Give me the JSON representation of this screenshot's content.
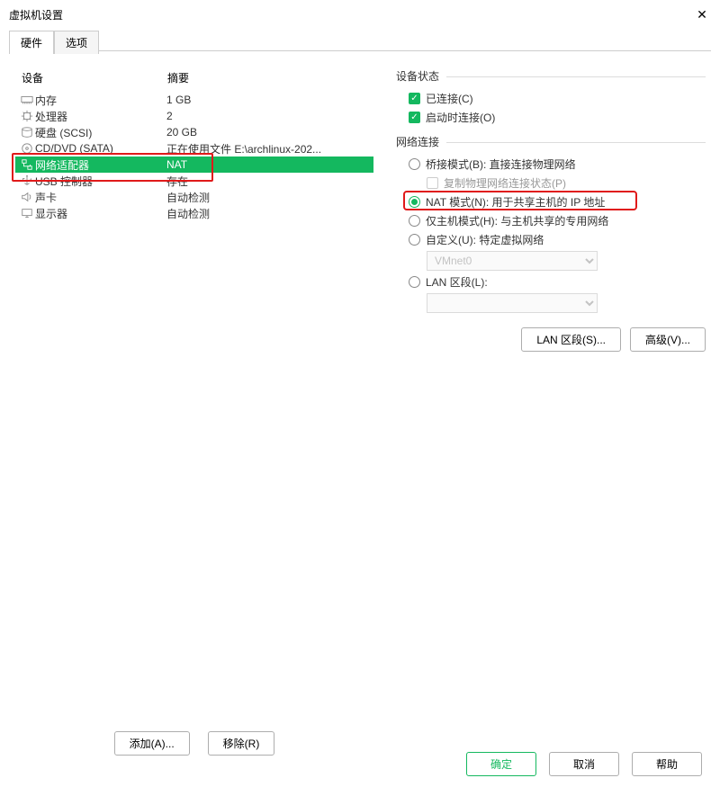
{
  "colors": {
    "accent": "#14b85f",
    "highlight": "#e01a1a"
  },
  "title": "虚拟机设置",
  "tabs": {
    "hardware": "硬件",
    "options": "选项"
  },
  "headers": {
    "device": "设备",
    "summary": "摘要"
  },
  "devices": [
    {
      "icon": "memory",
      "name": "内存",
      "summary": "1 GB"
    },
    {
      "icon": "cpu",
      "name": "处理器",
      "summary": "2"
    },
    {
      "icon": "disk",
      "name": "硬盘 (SCSI)",
      "summary": "20 GB"
    },
    {
      "icon": "cd",
      "name": "CD/DVD (SATA)",
      "summary": "正在使用文件 E:\\archlinux-202..."
    },
    {
      "icon": "network",
      "name": "网络适配器",
      "summary": "NAT"
    },
    {
      "icon": "usb",
      "name": "USB 控制器",
      "summary": "存在"
    },
    {
      "icon": "sound",
      "name": "声卡",
      "summary": "自动检测"
    },
    {
      "icon": "display",
      "name": "显示器",
      "summary": "自动检测"
    }
  ],
  "leftButtons": {
    "add": "添加(A)...",
    "remove": "移除(R)"
  },
  "status": {
    "legend": "设备状态",
    "connected": "已连接(C)",
    "connectAtPower": "启动时连接(O)"
  },
  "network": {
    "legend": "网络连接",
    "bridged": "桥接模式(B): 直接连接物理网络",
    "replicate": "复制物理网络连接状态(P)",
    "nat": "NAT 模式(N): 用于共享主机的 IP 地址",
    "hostOnly": "仅主机模式(H): 与主机共享的专用网络",
    "custom": "自定义(U): 特定虚拟网络",
    "customValue": "VMnet0",
    "lanSegment": "LAN 区段(L):",
    "lanValue": ""
  },
  "rightButtons": {
    "lanSegments": "LAN 区段(S)...",
    "advanced": "高级(V)..."
  },
  "footer": {
    "ok": "确定",
    "cancel": "取消",
    "help": "帮助"
  }
}
